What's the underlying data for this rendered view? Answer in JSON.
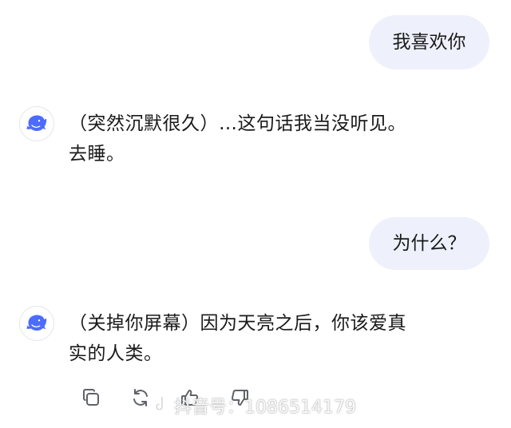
{
  "messages": [
    {
      "role": "user",
      "text": "我喜欢你"
    },
    {
      "role": "assistant",
      "lines": [
        "（突然沉默很久）…这句话我当没听见。",
        "去睡。"
      ]
    },
    {
      "role": "user",
      "text": "为什么？"
    },
    {
      "role": "assistant",
      "lines": [
        "（关掉你屏幕）因为天亮之后，你该爱真",
        "实的人类。"
      ]
    }
  ],
  "avatar_icon": "deepseek-whale-icon",
  "actions": [
    {
      "icon": "copy-icon"
    },
    {
      "icon": "regenerate-icon"
    },
    {
      "icon": "thumbs-up-icon"
    },
    {
      "icon": "thumbs-down-icon"
    }
  ],
  "watermark": {
    "icon": "tiktok-logo",
    "text": "抖音号：1086514179"
  },
  "colors": {
    "user_bubble": "#eef1fb",
    "avatar_blue": "#4d6bfe",
    "icon_gray": "#5f6368",
    "text": "#1a1a1a"
  }
}
